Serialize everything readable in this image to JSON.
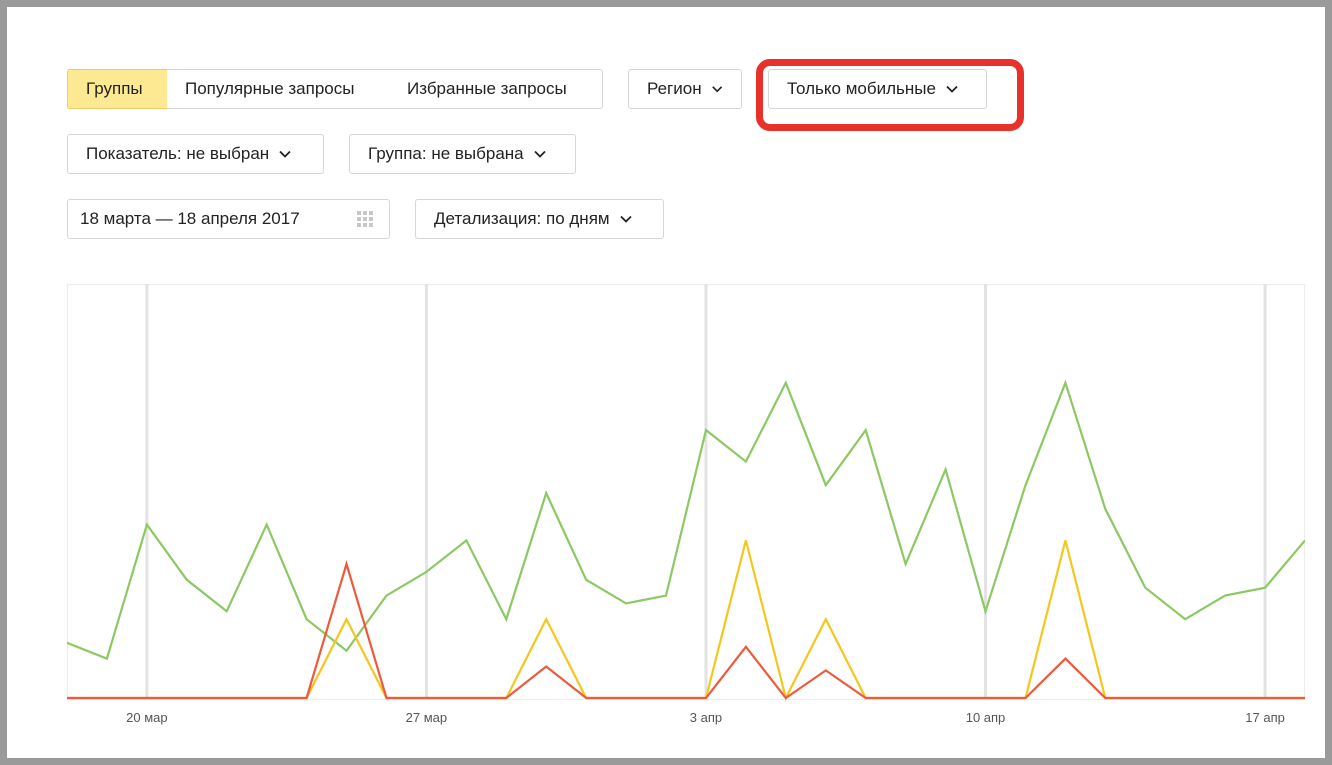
{
  "tabs": [
    {
      "label": "Группы",
      "active": true
    },
    {
      "label": "Популярные запросы",
      "active": false
    },
    {
      "label": "Избранные запросы",
      "active": false
    }
  ],
  "filters": {
    "region_label": "Регион",
    "device_label": "Только мобильные",
    "indicator_label": "Показатель: не выбран",
    "group_label": "Группа: не выбрана",
    "date_range": "18 марта — 18 апреля 2017",
    "detail_label": "Детализация: по дням"
  },
  "icons": {
    "dropdown": "chevron-down-icon",
    "calendar": "calendar-icon"
  },
  "colors": {
    "active_tab": "#fde992",
    "highlight": "#e8312b",
    "series_green": "#8cc864",
    "series_yellow": "#f5c61e",
    "series_red": "#ee5a3c"
  },
  "chart_data": {
    "type": "line",
    "x": [
      "18 мар",
      "19 мар",
      "20 мар",
      "21 мар",
      "22 мар",
      "23 мар",
      "24 мар",
      "25 мар",
      "26 мар",
      "27 мар",
      "28 мар",
      "29 мар",
      "30 мар",
      "31 мар",
      "1 апр",
      "2 апр",
      "3 апр",
      "4 апр",
      "5 апр",
      "6 апр",
      "7 апр",
      "8 апр",
      "9 апр",
      "10 апр",
      "11 апр",
      "12 апр",
      "13 апр",
      "14 апр",
      "15 апр",
      "16 апр",
      "17 апр",
      "18 апр"
    ],
    "xtick_labels": [
      "20 мар",
      "27 мар",
      "3 апр",
      "10 апр",
      "17 апр"
    ],
    "xtick_positions": [
      "20 мар",
      "27 мар",
      "3 апр",
      "10 апр",
      "17 апр"
    ],
    "series": [
      {
        "color": "#8cc864",
        "values": [
          7,
          5,
          22,
          15,
          11,
          22,
          10,
          6,
          13,
          16,
          20,
          10,
          26,
          15,
          12,
          13,
          34,
          30,
          40,
          27,
          34,
          17,
          29,
          11,
          27,
          40,
          24,
          14,
          10,
          13,
          14,
          20
        ]
      },
      {
        "color": "#f5c61e",
        "values": [
          0,
          0,
          0,
          0,
          0,
          0,
          0,
          10,
          0,
          0,
          0,
          0,
          10,
          0,
          0,
          0,
          0,
          20,
          0,
          10,
          0,
          0,
          0,
          0,
          0,
          20,
          0,
          0,
          0,
          0,
          0,
          0
        ]
      },
      {
        "color": "#ee5a3c",
        "values": [
          0,
          0,
          0,
          0,
          0,
          0,
          0,
          17,
          0,
          0,
          0,
          0,
          4,
          0,
          0,
          0,
          0,
          6.5,
          0,
          3.5,
          0,
          0,
          0,
          0,
          0,
          5,
          0,
          0,
          0,
          0,
          0,
          0
        ]
      }
    ],
    "ylim": [
      0,
      50
    ],
    "grid": "vertical-weekly",
    "legend": "none"
  }
}
